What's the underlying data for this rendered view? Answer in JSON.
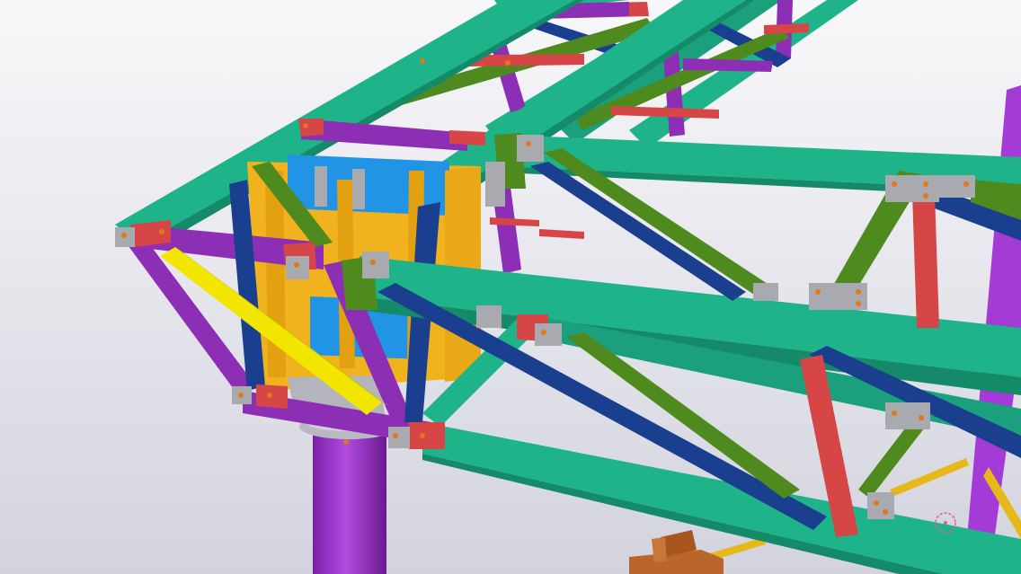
{
  "scene": {
    "kind": "3d-steel-truss-model",
    "colors": {
      "background_top": "#f7f7f9",
      "background_bottom": "#d6d6e0",
      "teal_chord": "#1fb38a",
      "teal_shadow": "#158a69",
      "purple_member": "#8c2fb5",
      "purple_column": "#a43bd6",
      "navy_brace": "#1a3f8f",
      "green_brace": "#4f8a1e",
      "red_member": "#d64646",
      "yellow_member": "#f2e600",
      "orange_plate": "#f0b21d",
      "blue_plate": "#2294e6",
      "gray_connection": "#a9a9b0",
      "bolt_orange": "#e0781b",
      "wood_block": "#b9652b",
      "gold_rod": "#e6b81a",
      "pink_marker": "#e05ca0"
    },
    "icons": {
      "marker": "circle-target-icon"
    }
  }
}
